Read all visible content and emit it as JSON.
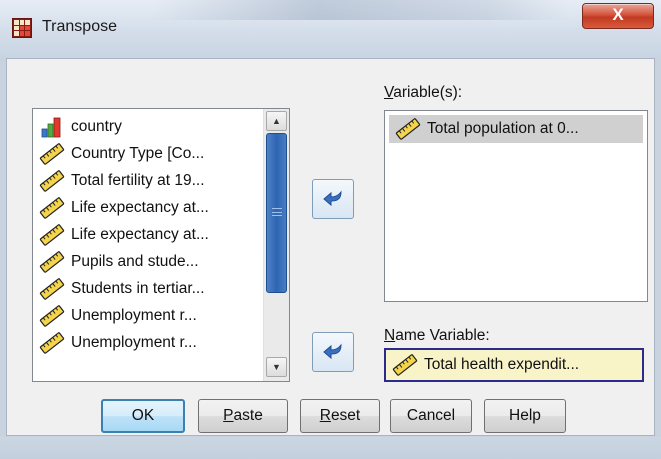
{
  "window": {
    "title": "Transpose",
    "close_label": "X"
  },
  "source_list": {
    "items": [
      {
        "label": "country",
        "icon": "nominal-bar-chart-icon"
      },
      {
        "label": "Country Type [Co...",
        "icon": "scale-ruler-icon"
      },
      {
        "label": "Total fertility at 19...",
        "icon": "scale-ruler-icon"
      },
      {
        "label": "Life expectancy at...",
        "icon": "scale-ruler-icon"
      },
      {
        "label": "Life expectancy at...",
        "icon": "scale-ruler-icon"
      },
      {
        "label": "Pupils and stude...",
        "icon": "scale-ruler-icon"
      },
      {
        "label": "Students in tertiar...",
        "icon": "scale-ruler-icon"
      },
      {
        "label": "Unemployment r...",
        "icon": "scale-ruler-icon"
      },
      {
        "label": "Unemployment r...",
        "icon": "scale-ruler-icon"
      }
    ]
  },
  "variables": {
    "label_prefix": "V",
    "label_rest": "ariable(s):",
    "items": [
      {
        "label": "Total population at 0...",
        "icon": "scale-ruler-icon"
      }
    ]
  },
  "name_variable": {
    "label_prefix": "N",
    "label_rest": "ame Variable:",
    "value": "Total health expendit...",
    "icon": "scale-ruler-icon"
  },
  "buttons": {
    "ok": "OK",
    "paste_prefix": "P",
    "paste_rest": "aste",
    "reset_prefix": "R",
    "reset_rest": "eset",
    "cancel": "Cancel",
    "help": "Help"
  },
  "colors": {
    "accent_blue": "#2e65b3",
    "name_field_bg": "#f8f4c8",
    "selected_bg": "#d0d0d0"
  }
}
